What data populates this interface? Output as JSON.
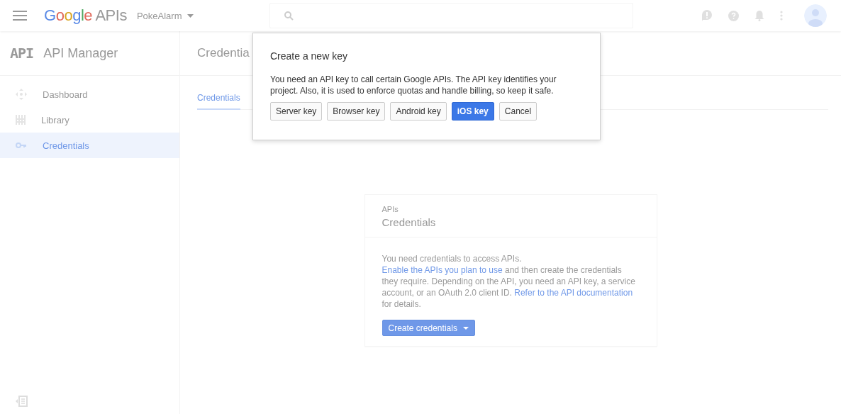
{
  "header": {
    "brand": "Google",
    "product": "APIs",
    "project": "PokeAlarm"
  },
  "sidebar": {
    "logo": "API",
    "title": "API Manager",
    "items": [
      {
        "label": "Dashboard",
        "kind": "dashboard",
        "selected": false
      },
      {
        "label": "Library",
        "kind": "library",
        "selected": false
      },
      {
        "label": "Credentials",
        "kind": "credentials",
        "selected": true
      }
    ]
  },
  "main": {
    "title": "Credentia",
    "tabs": [
      {
        "label": "Credentials",
        "selected": true
      }
    ]
  },
  "card": {
    "eyebrow": "APIs",
    "title": "Credentials",
    "body": [
      {
        "text": "You need credentials to access APIs. ",
        "link": false
      },
      {
        "text": "Enable the APIs you plan to ",
        "link": true
      },
      {
        "text": "use",
        "link": true
      },
      {
        "text": " and then create the credentials they require. Depending on the API, you need an API key, a service account, or an OAuth 2.0 client ID. ",
        "link": false
      },
      {
        "text": "Refer to the API documentation",
        "link": true
      },
      {
        "text": " for details.",
        "link": false
      }
    ],
    "button": "Create credentials"
  },
  "dialog": {
    "title": "Create a new key",
    "text": "You need an API key to call certain Google APIs. The API key identifies your project. Also, it is used to enforce quotas and handle billing, so keep it safe.",
    "buttons": [
      {
        "label": "Server key",
        "kind": "default"
      },
      {
        "label": "Browser key",
        "kind": "default"
      },
      {
        "label": "Android key",
        "kind": "default"
      },
      {
        "label": "iOS key",
        "kind": "primary"
      },
      {
        "label": "Cancel",
        "kind": "default"
      }
    ]
  }
}
